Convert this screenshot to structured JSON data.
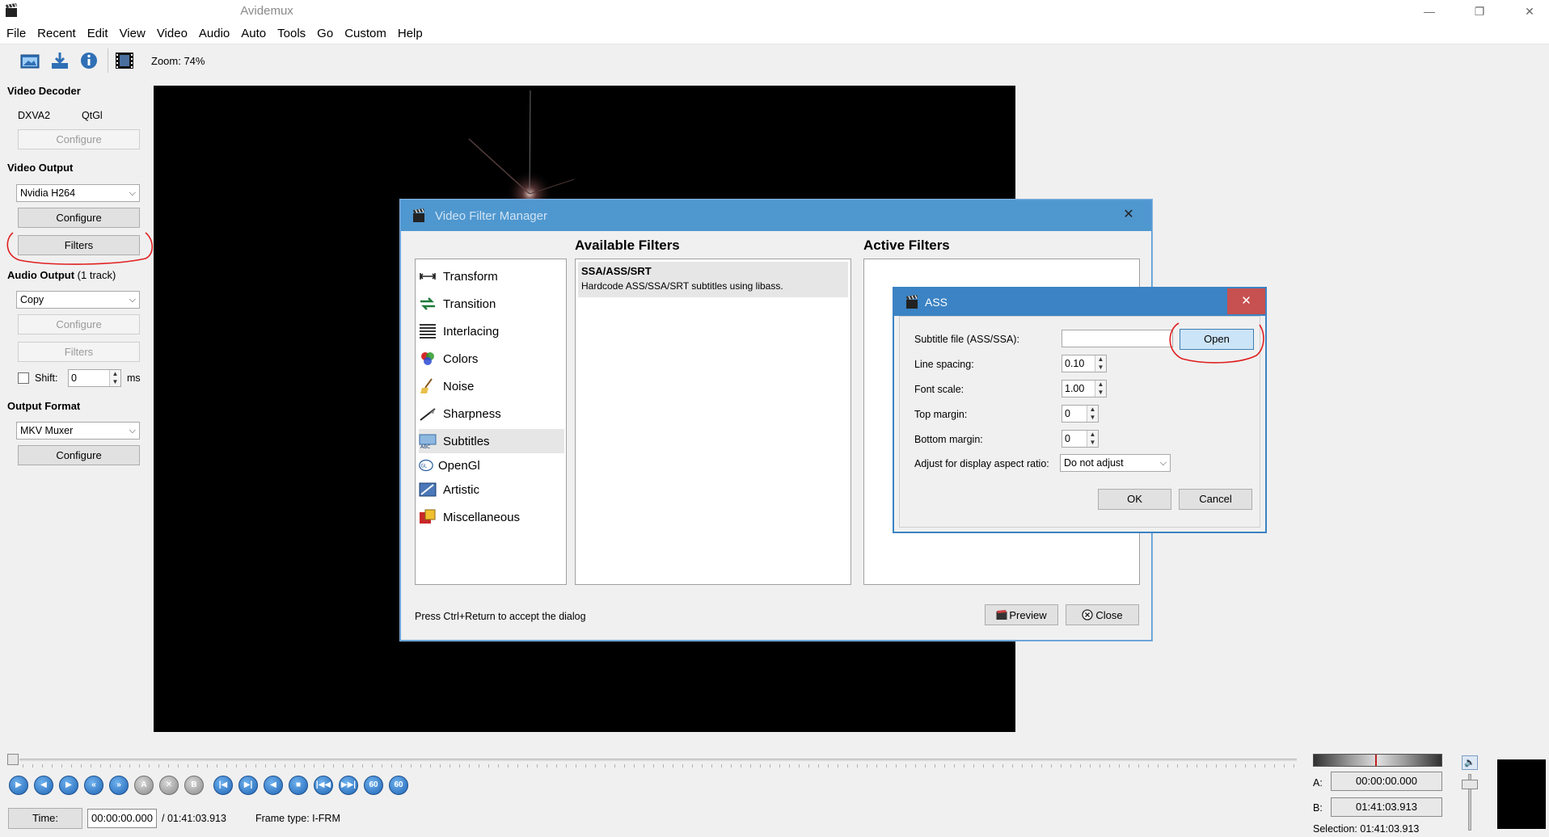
{
  "window": {
    "title": "Avidemux",
    "controls": {
      "minimize": "—",
      "restore": "❐",
      "close": "✕"
    }
  },
  "menu": [
    "File",
    "Recent",
    "Edit",
    "View",
    "Video",
    "Audio",
    "Auto",
    "Tools",
    "Go",
    "Custom",
    "Help"
  ],
  "toolbar": {
    "zoom_label": "Zoom: 74%"
  },
  "left_panel": {
    "video_decoder": {
      "title": "Video Decoder",
      "dec1": "DXVA2",
      "dec2": "QtGl",
      "configure": "Configure"
    },
    "video_output": {
      "title": "Video Output",
      "codec": "Nvidia H264",
      "configure": "Configure",
      "filters": "Filters"
    },
    "audio_output": {
      "title": "Audio Output",
      "tracks": "(1 track)",
      "codec": "Copy",
      "configure": "Configure",
      "filters": "Filters",
      "shift_label": "Shift:",
      "shift_value": "0",
      "shift_unit": "ms"
    },
    "output_format": {
      "title": "Output Format",
      "muxer": "MKV Muxer",
      "configure": "Configure"
    }
  },
  "filter_manager": {
    "title": "Video Filter Manager",
    "close_x": "✕",
    "available_title": "Available Filters",
    "active_title": "Active Filters",
    "categories": [
      {
        "label": "Transform",
        "icon": "transform-icon"
      },
      {
        "label": "Transition",
        "icon": "transition-icon"
      },
      {
        "label": "Interlacing",
        "icon": "interlacing-icon"
      },
      {
        "label": "Colors",
        "icon": "colors-icon"
      },
      {
        "label": "Noise",
        "icon": "noise-icon"
      },
      {
        "label": "Sharpness",
        "icon": "sharpness-icon"
      },
      {
        "label": "Subtitles",
        "icon": "subtitles-icon"
      },
      {
        "label": "OpenGl",
        "icon": "opengl-icon"
      },
      {
        "label": "Artistic",
        "icon": "artistic-icon"
      },
      {
        "label": "Miscellaneous",
        "icon": "miscellaneous-icon"
      }
    ],
    "selected_category": "Subtitles",
    "available_filters": [
      {
        "name": "SSA/ASS/SRT",
        "desc": "Hardcode ASS/SSA/SRT subtitles using libass."
      }
    ],
    "hint": "Press Ctrl+Return to accept the dialog",
    "preview_label": "Preview",
    "close_label": "Close"
  },
  "ass_dialog": {
    "title": "ASS",
    "close_x": "✕",
    "subtitle_file_label": "Subtitle file (ASS/SSA):",
    "subtitle_file_value": "",
    "open_label": "Open",
    "line_spacing_label": "Line spacing:",
    "line_spacing_value": "0.10",
    "font_scale_label": "Font scale:",
    "font_scale_value": "1.00",
    "top_margin_label": "Top margin:",
    "top_margin_value": "0",
    "bottom_margin_label": "Bottom margin:",
    "bottom_margin_value": "0",
    "aspect_label": "Adjust for display aspect ratio:",
    "aspect_value": "Do not adjust",
    "ok_label": "OK",
    "cancel_label": "Cancel"
  },
  "navigation": {
    "buttons": [
      "▶",
      "◀",
      "▶",
      "«",
      "»",
      "A",
      "✕",
      "B",
      "|◀",
      "▶|",
      "◀",
      "■",
      "|◀◀",
      "▶▶|",
      "60",
      "60"
    ]
  },
  "status": {
    "time_label": "Time:",
    "current_time": "00:00:00.000",
    "total_time": "/ 01:41:03.913",
    "frame_type": "Frame type:  I-FRM",
    "a_label": "A:",
    "a_time": "00:00:00.000",
    "b_label": "B:",
    "b_time": "01:41:03.913",
    "selection": "Selection: 01:41:03.913"
  },
  "colors": {
    "accent": "#3b83c4",
    "annotation": "#e02020"
  }
}
